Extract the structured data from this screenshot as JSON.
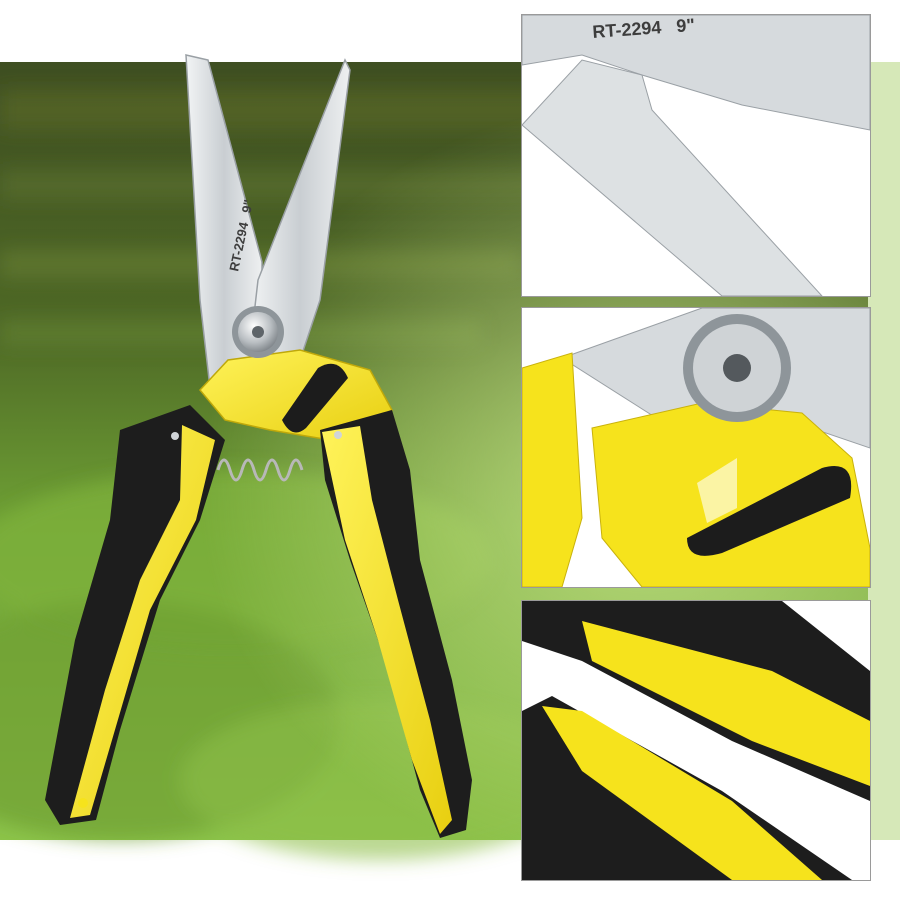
{
  "product": {
    "model_engraving": "RT-2294",
    "size_engraving": "9\""
  },
  "colors": {
    "handle_yellow": "#f6e31c",
    "handle_black": "#1d1d1d",
    "blade_steel": "#d9dde0",
    "background_green": "#4f8a2a",
    "inset_border": "#9a9a9a"
  },
  "insets": [
    {
      "subject": "blade-closeup"
    },
    {
      "subject": "pivot-and-lock-closeup"
    },
    {
      "subject": "handle-grip-closeup"
    }
  ]
}
